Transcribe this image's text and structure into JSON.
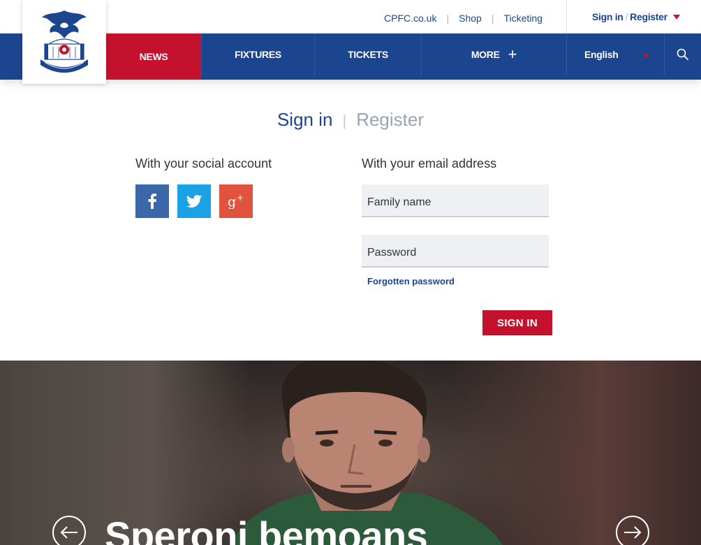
{
  "toplinks": {
    "site": "CPFC.co.uk",
    "shop": "Shop",
    "ticketing": "Ticketing"
  },
  "account": {
    "signin": "Sign in",
    "slash": "/",
    "register": "Register"
  },
  "nav": {
    "news": "NEWS",
    "fixtures": "FIXTURES",
    "tickets": "TICKETS",
    "more": "MORE",
    "language": "English"
  },
  "auth": {
    "tab_signin": "Sign in",
    "separator": "|",
    "tab_register": "Register",
    "social_title": "With your social account",
    "email_title": "With your email address",
    "family_name_placeholder": "Family name",
    "password_placeholder": "Password",
    "forgot": "Forgotten password",
    "signin_button": "SIGN IN"
  },
  "hero": {
    "headline": "Speroni bemoans"
  },
  "colors": {
    "brand_blue": "#1b458f",
    "brand_red": "#c4122e",
    "facebook": "#3a67a8",
    "twitter": "#1aa1e6",
    "google": "#e0533c"
  }
}
